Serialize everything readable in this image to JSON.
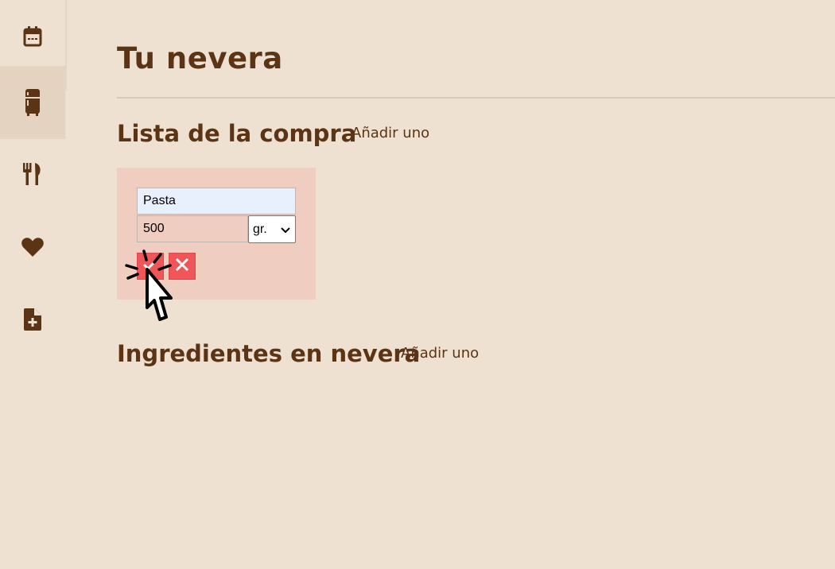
{
  "app": {
    "page_title": "Tu nevera"
  },
  "sidebar": {
    "items": [
      {
        "icon": "calendar-icon",
        "active": false
      },
      {
        "icon": "fridge-icon",
        "active": true
      },
      {
        "icon": "fork-knife-icon",
        "active": false
      },
      {
        "icon": "heart-icon",
        "active": false
      },
      {
        "icon": "file-plus-icon",
        "active": false
      }
    ]
  },
  "shopping_list": {
    "heading": "Lista de la compra",
    "add_label": "Añadir uno",
    "form": {
      "name_value": "Pasta",
      "quantity_value": "500",
      "unit_selected": "gr."
    }
  },
  "fridge_ingredients": {
    "heading": "Ingredientes en nevera",
    "add_label": "Añadir uno"
  },
  "colors": {
    "background": "#efe1d2",
    "sidebar_active": "#e5d3c1",
    "text_brown": "#5a3414",
    "form_card": "#efcdc1",
    "button_red": "#f0555a"
  }
}
